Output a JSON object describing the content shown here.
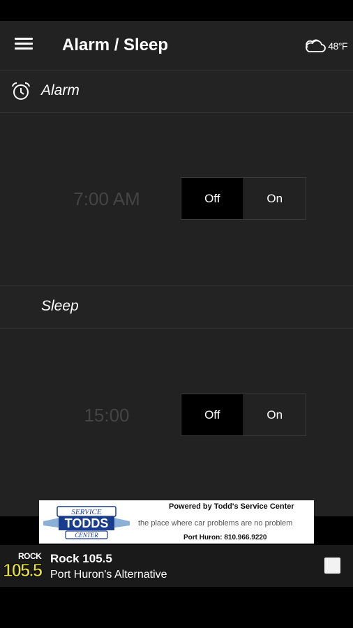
{
  "app": {
    "title": "Alarm / Sleep"
  },
  "weather": {
    "icon": "cloud-icon",
    "temp": "48°F"
  },
  "alarm": {
    "title": "Alarm",
    "icon": "alarm-clock-icon",
    "time": "7:00 AM",
    "off_label": "Off",
    "on_label": "On",
    "selected": "Off"
  },
  "sleep": {
    "title": "Sleep",
    "icon": "moon-icon",
    "duration": "15:00",
    "off_label": "Off",
    "on_label": "On",
    "selected": "Off"
  },
  "ad": {
    "logo_text_top": "SERVICE",
    "logo_text_main": "TODDS",
    "logo_text_bottom": "CENTER",
    "line1": "Powered by Todd's Service Center",
    "line2": "the place where car problems are no problem",
    "line3": "Port Huron: 810.966.9220"
  },
  "player": {
    "logo_top": "ROCK",
    "logo_num": "105.5",
    "station_name": "Rock 105.5",
    "tagline": "Port Huron's Alternative",
    "logo_color": "#e8e23a"
  }
}
